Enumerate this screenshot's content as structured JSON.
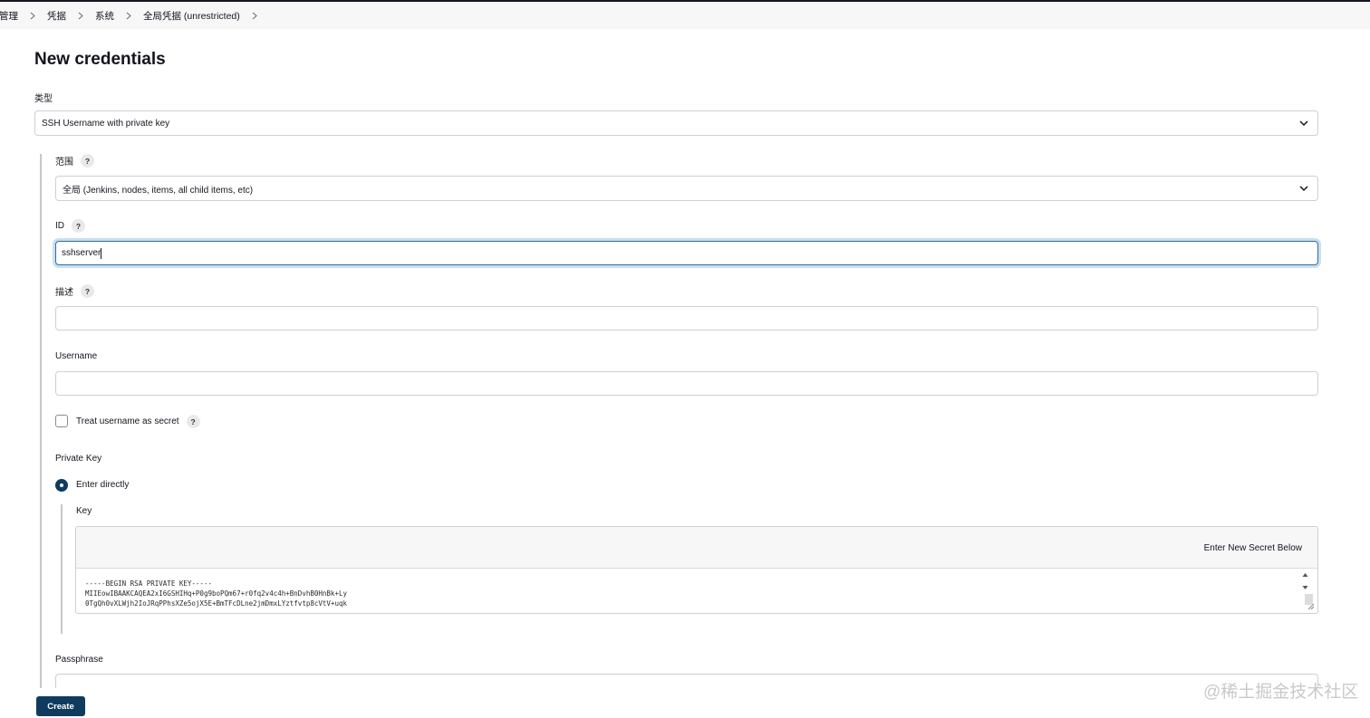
{
  "breadcrumb": {
    "items": [
      "凭据管理",
      "凭据",
      "系统",
      "全局凭据 (unrestricted)"
    ]
  },
  "page": {
    "title": "New credentials"
  },
  "form": {
    "kind_label": "类型",
    "kind_value": "SSH Username with private key",
    "scope_label": "范围",
    "scope_value": "全局 (Jenkins, nodes, items, all child items, etc)",
    "id_label": "ID",
    "id_value": "sshserver",
    "description_label": "描述",
    "description_value": "",
    "username_label": "Username",
    "username_value": "",
    "treat_secret_label": "Treat username as secret",
    "treat_secret_checked": false,
    "private_key_label": "Private Key",
    "enter_directly_label": "Enter directly",
    "enter_directly_selected": true,
    "key_label": "Key",
    "key_header": "Enter New Secret Below",
    "key_lines": [
      "-----BEGIN RSA PRIVATE KEY-----",
      "MIIEowIBAAKCAQEA2xI6GSHIHq+P0g9boPQm67+r0fq2v4c4h+BnDvhB0HnBk+Ly",
      "0TgQh0vXLWjh2IoJRqPPhsXZe5ojX5E+BmTFcDLne2jmDmxLYztfvtp8cVtV+uqk"
    ],
    "passphrase_label": "Passphrase",
    "help_glyph": "?"
  },
  "actions": {
    "create_label": "Create"
  },
  "watermark": "@稀土掘金技术社区",
  "colors": {
    "primary": "#0f3b5f",
    "focus_ring": "#2f6fa0",
    "breadcrumb_bg": "#f7f7f8",
    "border": "#cfcfd4"
  }
}
